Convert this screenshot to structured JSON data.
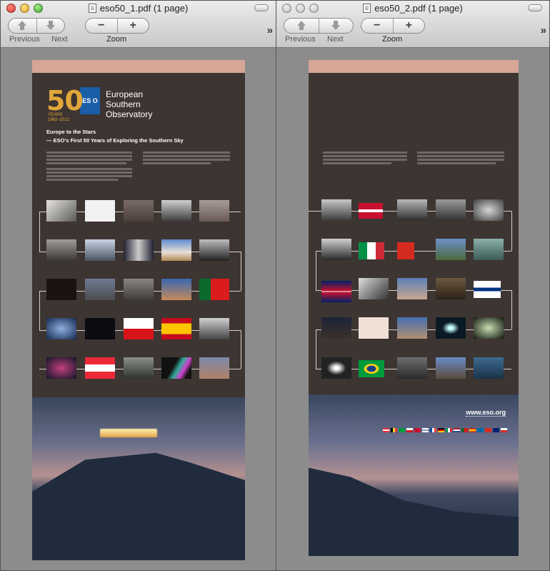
{
  "windows": [
    {
      "title": "eso50_1.pdf (1 page)",
      "toolbar": {
        "previous": "Previous",
        "next": "Next",
        "zoom": "Zoom"
      }
    },
    {
      "title": "eso50_2.pdf (1 page)",
      "toolbar": {
        "previous": "Previous",
        "next": "Next",
        "zoom": "Zoom"
      }
    }
  ],
  "page1": {
    "anniversary_number": "50",
    "anniversary_label": "YEARS",
    "anniversary_range": "1962–2012",
    "eso_mark": "ES O",
    "org_name": [
      "European",
      "Southern",
      "Observatory"
    ],
    "heading": "Europe to the Stars",
    "subheading": "— ESO's First 50 Years of Exploring the Southern Sky"
  },
  "page2": {
    "url": "www.eso.org"
  },
  "colors": {
    "page_bg": "#3d3532",
    "band": "#d6a697",
    "eso_blue": "#1a5ea8",
    "gold": "#e1a73a"
  }
}
